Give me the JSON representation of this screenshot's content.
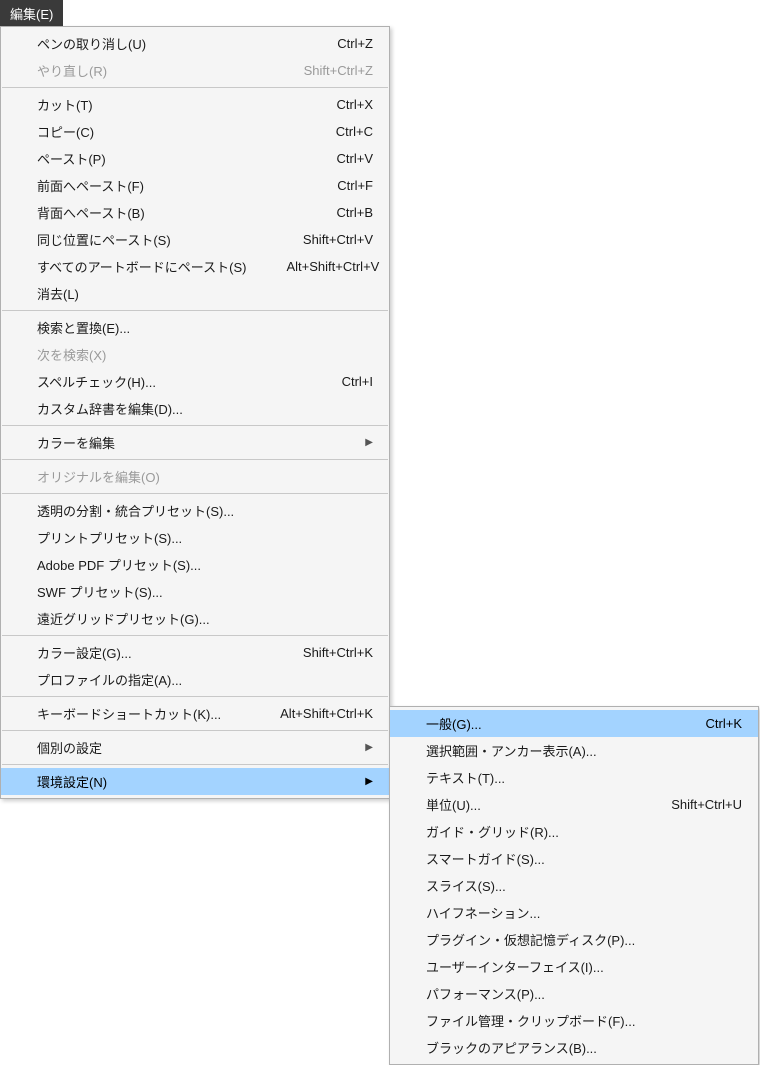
{
  "menuButton": {
    "label": "編集(E)"
  },
  "mainMenu": [
    {
      "type": "item",
      "label": "ペンの取り消し(U)",
      "shortcut": "Ctrl+Z",
      "disabled": false
    },
    {
      "type": "item",
      "label": "やり直し(R)",
      "shortcut": "Shift+Ctrl+Z",
      "disabled": true
    },
    {
      "type": "sep"
    },
    {
      "type": "item",
      "label": "カット(T)",
      "shortcut": "Ctrl+X",
      "disabled": false
    },
    {
      "type": "item",
      "label": "コピー(C)",
      "shortcut": "Ctrl+C",
      "disabled": false
    },
    {
      "type": "item",
      "label": "ペースト(P)",
      "shortcut": "Ctrl+V",
      "disabled": false
    },
    {
      "type": "item",
      "label": "前面へペースト(F)",
      "shortcut": "Ctrl+F",
      "disabled": false
    },
    {
      "type": "item",
      "label": "背面へペースト(B)",
      "shortcut": "Ctrl+B",
      "disabled": false
    },
    {
      "type": "item",
      "label": "同じ位置にペースト(S)",
      "shortcut": "Shift+Ctrl+V",
      "disabled": false
    },
    {
      "type": "item",
      "label": "すべてのアートボードにペースト(S)",
      "shortcut": "Alt+Shift+Ctrl+V",
      "disabled": false
    },
    {
      "type": "item",
      "label": "消去(L)",
      "shortcut": "",
      "disabled": false
    },
    {
      "type": "sep"
    },
    {
      "type": "item",
      "label": "検索と置換(E)...",
      "shortcut": "",
      "disabled": false
    },
    {
      "type": "item",
      "label": "次を検索(X)",
      "shortcut": "",
      "disabled": true
    },
    {
      "type": "item",
      "label": "スペルチェック(H)...",
      "shortcut": "Ctrl+I",
      "disabled": false
    },
    {
      "type": "item",
      "label": "カスタム辞書を編集(D)...",
      "shortcut": "",
      "disabled": false
    },
    {
      "type": "sep"
    },
    {
      "type": "item",
      "label": "カラーを編集",
      "shortcut": "",
      "disabled": false,
      "submenu": true
    },
    {
      "type": "sep"
    },
    {
      "type": "item",
      "label": "オリジナルを編集(O)",
      "shortcut": "",
      "disabled": true
    },
    {
      "type": "sep"
    },
    {
      "type": "item",
      "label": "透明の分割・統合プリセット(S)...",
      "shortcut": "",
      "disabled": false
    },
    {
      "type": "item",
      "label": "プリントプリセット(S)...",
      "shortcut": "",
      "disabled": false
    },
    {
      "type": "item",
      "label": "Adobe PDF プリセット(S)...",
      "shortcut": "",
      "disabled": false
    },
    {
      "type": "item",
      "label": "SWF プリセット(S)...",
      "shortcut": "",
      "disabled": false
    },
    {
      "type": "item",
      "label": "遠近グリッドプリセット(G)...",
      "shortcut": "",
      "disabled": false
    },
    {
      "type": "sep"
    },
    {
      "type": "item",
      "label": "カラー設定(G)...",
      "shortcut": "Shift+Ctrl+K",
      "disabled": false
    },
    {
      "type": "item",
      "label": "プロファイルの指定(A)...",
      "shortcut": "",
      "disabled": false
    },
    {
      "type": "sep"
    },
    {
      "type": "item",
      "label": "キーボードショートカット(K)...",
      "shortcut": "Alt+Shift+Ctrl+K",
      "disabled": false
    },
    {
      "type": "sep"
    },
    {
      "type": "item",
      "label": "個別の設定",
      "shortcut": "",
      "disabled": false,
      "submenu": true
    },
    {
      "type": "sep"
    },
    {
      "type": "item",
      "label": "環境設定(N)",
      "shortcut": "",
      "disabled": false,
      "submenu": true,
      "highlighted": true
    }
  ],
  "subMenu": [
    {
      "type": "item",
      "label": "一般(G)...",
      "shortcut": "Ctrl+K",
      "disabled": false,
      "highlighted": true
    },
    {
      "type": "item",
      "label": "選択範囲・アンカー表示(A)...",
      "shortcut": "",
      "disabled": false
    },
    {
      "type": "item",
      "label": "テキスト(T)...",
      "shortcut": "",
      "disabled": false
    },
    {
      "type": "item",
      "label": "単位(U)...",
      "shortcut": "Shift+Ctrl+U",
      "disabled": false
    },
    {
      "type": "item",
      "label": "ガイド・グリッド(R)...",
      "shortcut": "",
      "disabled": false
    },
    {
      "type": "item",
      "label": "スマートガイド(S)...",
      "shortcut": "",
      "disabled": false
    },
    {
      "type": "item",
      "label": "スライス(S)...",
      "shortcut": "",
      "disabled": false
    },
    {
      "type": "item",
      "label": "ハイフネーション...",
      "shortcut": "",
      "disabled": false
    },
    {
      "type": "item",
      "label": "プラグイン・仮想記憶ディスク(P)...",
      "shortcut": "",
      "disabled": false
    },
    {
      "type": "item",
      "label": "ユーザーインターフェイス(I)...",
      "shortcut": "",
      "disabled": false
    },
    {
      "type": "item",
      "label": "パフォーマンス(P)...",
      "shortcut": "",
      "disabled": false
    },
    {
      "type": "item",
      "label": "ファイル管理・クリップボード(F)...",
      "shortcut": "",
      "disabled": false
    },
    {
      "type": "item",
      "label": "ブラックのアピアランス(B)...",
      "shortcut": "",
      "disabled": false
    }
  ]
}
